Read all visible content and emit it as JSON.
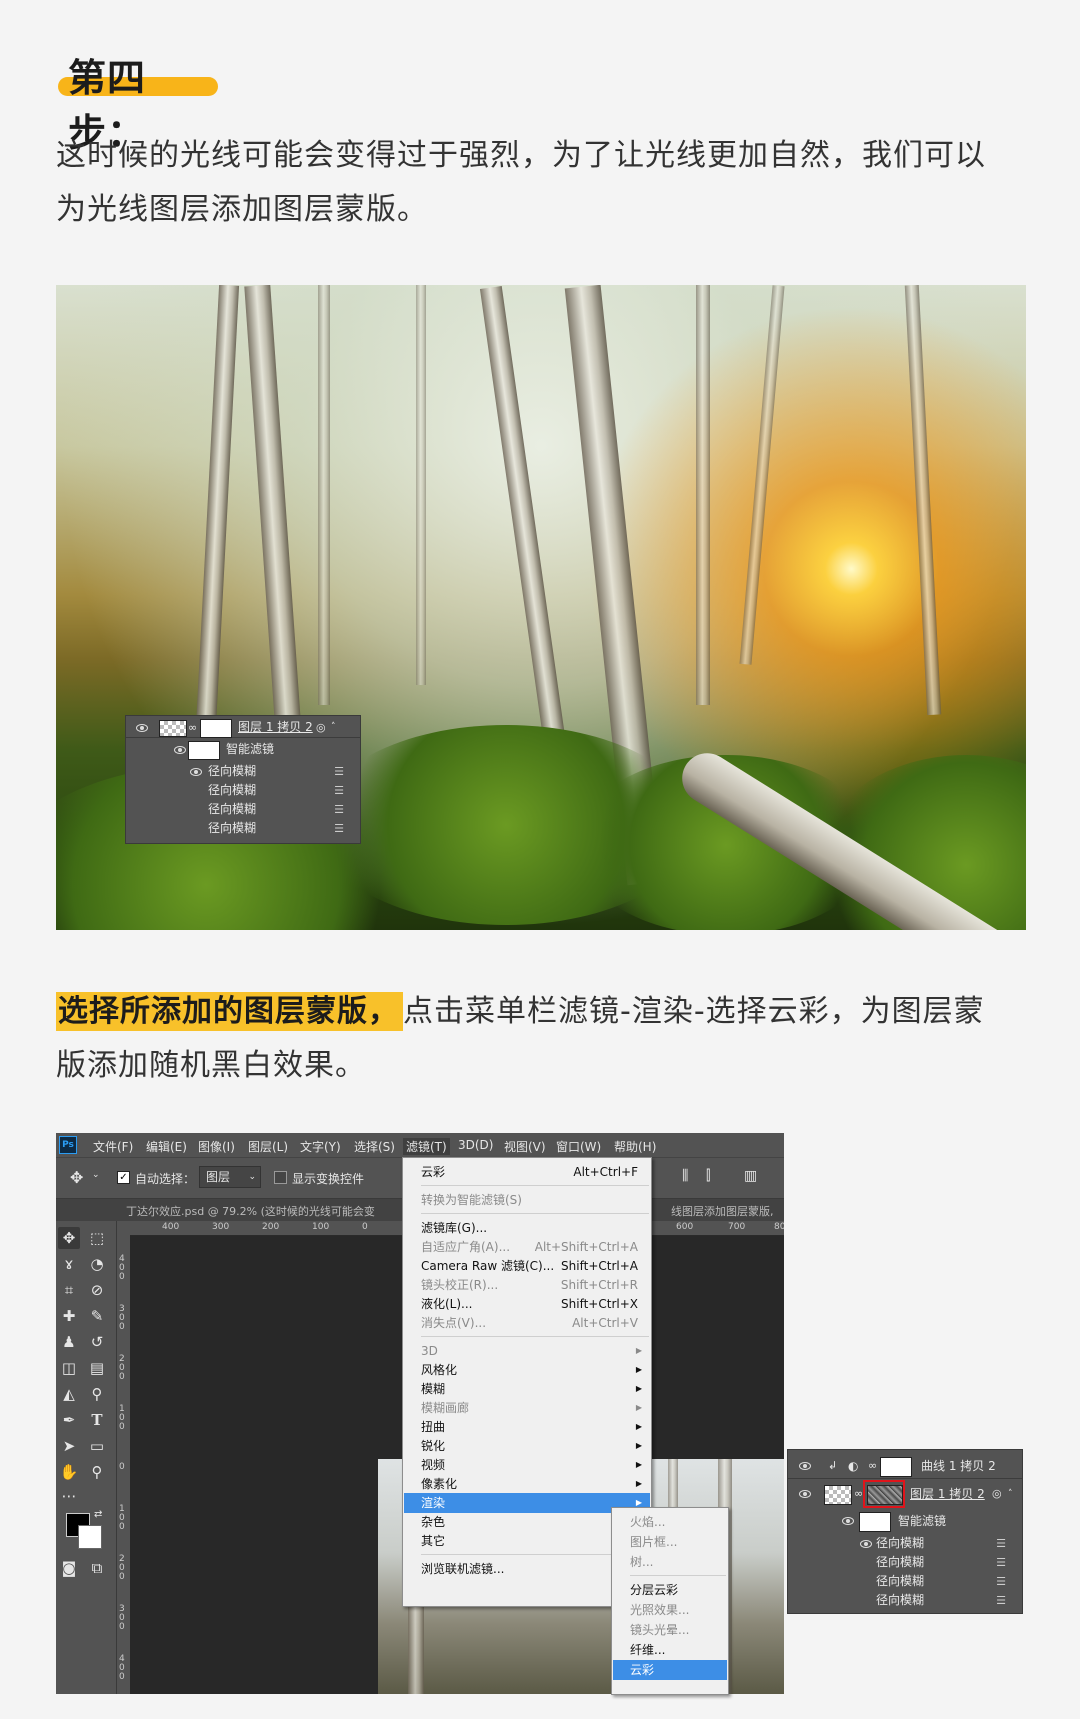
{
  "step": {
    "heading": "第四步："
  },
  "intro": {
    "line1": "这时候的光线可能会变得过于强烈，为了让光线更加自然，我们可以",
    "line2": "为光线图层添加图层蒙版。"
  },
  "instruction": {
    "highlight": "选择所添加的图层蒙版，",
    "rest1": "点击菜单栏滤镜-渲染-选择云彩，为图层蒙",
    "line2": "版添加随机黑白效果。"
  },
  "layers_panel_1": {
    "layer_name": "图层 1 拷贝 2",
    "smart_filter": "智能滤镜",
    "filters": [
      "径向模糊",
      "径向模糊",
      "径向模糊",
      "径向模糊"
    ]
  },
  "photoshop": {
    "app_icon": "Ps",
    "menubar": [
      "文件(F)",
      "编辑(E)",
      "图像(I)",
      "图层(L)",
      "文字(Y)",
      "选择(S)",
      "滤镜(T)",
      "3D(D)",
      "视图(V)",
      "窗口(W)",
      "帮助(H)"
    ],
    "options": {
      "auto_select_label": "自动选择：",
      "auto_select_value": "图层",
      "show_transform_label": "显示变换控件"
    },
    "doc_tab": "丁达尔效应.psd @ 79.2% (这时候的光线可能会变",
    "doc_tab_right": "线图层添加图层蒙版,",
    "ruler_h": [
      "400",
      "300",
      "200",
      "100",
      "0"
    ],
    "ruler_h_right": [
      "600",
      "700",
      "80"
    ],
    "ruler_v": [
      "4 0 0",
      "3 0 0",
      "2 0 0",
      "1 0 0",
      "0",
      "1 0 0",
      "2 0 0",
      "3 0 0",
      "4 0 0"
    ],
    "filter_menu": {
      "top": [
        {
          "label": "云彩",
          "shortcut": "Alt+Ctrl+F",
          "disabled": false
        }
      ],
      "group1": [
        {
          "label": "转换为智能滤镜(S)",
          "shortcut": "",
          "disabled": true
        }
      ],
      "group2": [
        {
          "label": "滤镜库(G)...",
          "shortcut": "",
          "disabled": false
        },
        {
          "label": "自适应广角(A)...",
          "shortcut": "Alt+Shift+Ctrl+A",
          "disabled": true
        },
        {
          "label": "Camera Raw 滤镜(C)...",
          "shortcut": "Shift+Ctrl+A",
          "disabled": false
        },
        {
          "label": "镜头校正(R)...",
          "shortcut": "Shift+Ctrl+R",
          "disabled": true
        },
        {
          "label": "液化(L)...",
          "shortcut": "Shift+Ctrl+X",
          "disabled": false
        },
        {
          "label": "消失点(V)...",
          "shortcut": "Alt+Ctrl+V",
          "disabled": true
        }
      ],
      "group3": [
        {
          "label": "3D",
          "disabled": true
        },
        {
          "label": "风格化",
          "disabled": false
        },
        {
          "label": "模糊",
          "disabled": false
        },
        {
          "label": "模糊画廊",
          "disabled": true
        },
        {
          "label": "扭曲",
          "disabled": false
        },
        {
          "label": "锐化",
          "disabled": false
        },
        {
          "label": "视频",
          "disabled": false
        },
        {
          "label": "像素化",
          "disabled": false
        },
        {
          "label": "渲染",
          "disabled": false,
          "hover": true
        },
        {
          "label": "杂色",
          "disabled": false
        },
        {
          "label": "其它",
          "disabled": false
        }
      ],
      "group4": [
        {
          "label": "浏览联机滤镜...",
          "disabled": false
        }
      ]
    },
    "render_submenu": {
      "group1": [
        {
          "label": "火焰...",
          "disabled": true
        },
        {
          "label": "图片框...",
          "disabled": true
        },
        {
          "label": "树...",
          "disabled": true
        }
      ],
      "group2": [
        {
          "label": "分层云彩",
          "disabled": false
        },
        {
          "label": "光照效果...",
          "disabled": true
        },
        {
          "label": "镜头光晕...",
          "disabled": true
        },
        {
          "label": "纤维...",
          "disabled": false
        },
        {
          "label": "云彩",
          "disabled": false,
          "selected": true
        }
      ]
    }
  },
  "layers_panel_2": {
    "curve_layer": "曲线 1 拷贝 2",
    "layer_name": "图层 1 拷贝 2",
    "smart_filter": "智能滤镜",
    "filters": [
      "径向模糊",
      "径向模糊",
      "径向模糊",
      "径向模糊"
    ]
  },
  "colors": {
    "accent_yellow": "#f8b419",
    "menu_highlight": "#3d8ee6",
    "mask_outline": "#e0141b",
    "ps_panel": "#535353"
  }
}
